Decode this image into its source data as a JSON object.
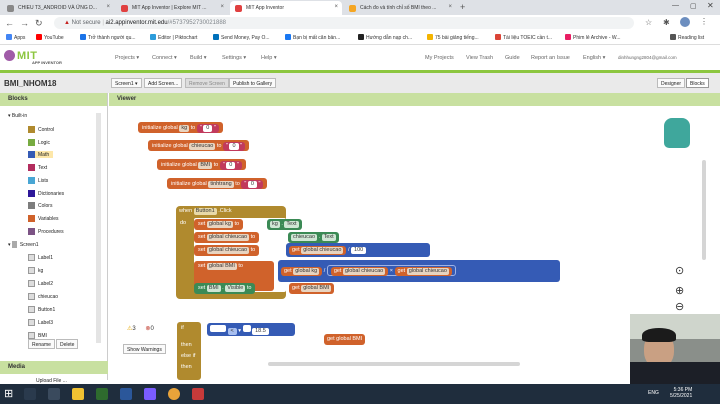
{
  "browser": {
    "tabs": [
      {
        "title": "CHIEU T3_ANDROID VÀ ỨNG D...",
        "favicon_color": "#888888"
      },
      {
        "title": "MIT App Inventor | Explore MIT ...",
        "favicon_color": "#e04040"
      },
      {
        "title": "MIT App Inventor",
        "favicon_color": "#e04040"
      },
      {
        "title": "Cách đo và tính chỉ số BMI theo ...",
        "favicon_color": "#f5a623"
      }
    ],
    "url_not_secure": "Not secure",
    "url_host": "ai2.appinventor.mit.edu",
    "url_rest": "/#5737952730021888",
    "bookmarks": [
      {
        "label": "Apps",
        "color": "#4285f4"
      },
      {
        "label": "YouTube",
        "color": "#ff0000"
      },
      {
        "label": "Trở thành người qu...",
        "color": "#1a73e8"
      },
      {
        "label": "Editor | Piktochart",
        "color": "#2c9cdb"
      },
      {
        "label": "Send Money, Pay O...",
        "color": "#0070ba"
      },
      {
        "label": "Bạn bị mất căn bản...",
        "color": "#1877f2"
      },
      {
        "label": "Hướng dẫn nạp ch...",
        "color": "#222222"
      },
      {
        "label": "75 bài giảng tiếng...",
        "color": "#f4b400"
      },
      {
        "label": "Tài liệu TOEIC cần t...",
        "color": "#db4437"
      },
      {
        "label": "Phim lẻ Archive - W...",
        "color": "#e91e63"
      }
    ],
    "reading_list": "Reading list"
  },
  "app": {
    "logo_main": "MIT",
    "logo_sub": "APP INVENTOR",
    "menus": [
      "Projects",
      "Connect",
      "Build",
      "Settings",
      "Help"
    ],
    "right_menus": [
      "My Projects",
      "View Trash",
      "Guide",
      "Report an Issue",
      "English",
      "dinhhungng2804@gmail.com"
    ],
    "project_name": "BMI_NHOM18",
    "toolbar": {
      "screen": "Screen1",
      "add_screen": "Add Screen...",
      "remove_screen": "Remove Screen",
      "publish": "Publish to Gallery",
      "designer": "Designer",
      "blocks": "Blocks"
    }
  },
  "blocks_panel": {
    "title": "Blocks",
    "builtin": "Built-in",
    "builtin_items": [
      {
        "label": "Control",
        "color": "#b08a2e"
      },
      {
        "label": "Logic",
        "color": "#77ab41"
      },
      {
        "label": "Math",
        "color": "#355bb5"
      },
      {
        "label": "Text",
        "color": "#b32d5e"
      },
      {
        "label": "Lists",
        "color": "#49a6d4"
      },
      {
        "label": "Dictionaries",
        "color": "#2d1799"
      },
      {
        "label": "Colors",
        "color": "#7d7d7d"
      },
      {
        "label": "Variables",
        "color": "#d0622b"
      },
      {
        "label": "Procedures",
        "color": "#7c5385"
      }
    ],
    "screen": "Screen1",
    "screen_items": [
      "Label1",
      "kg",
      "Label2",
      "chieucao",
      "Button1",
      "Label3",
      "BMI"
    ],
    "rename": "Rename",
    "delete": "Delete",
    "media_title": "Media",
    "upload": "Upload File ..."
  },
  "viewer": {
    "title": "Viewer",
    "globals": [
      {
        "label": "initialize global",
        "name": "kg",
        "to": "to",
        "value": "0"
      },
      {
        "label": "initialize global",
        "name": "chieucao",
        "to": "to",
        "value": "0"
      },
      {
        "label": "initialize global",
        "name": "BMI",
        "to": "to",
        "value": "0"
      },
      {
        "label": "initialize global",
        "name": "tinhtrang",
        "to": "to",
        "value": "0"
      }
    ],
    "event": {
      "when": "when",
      "component": "Button1",
      "event": ".Click",
      "do": "do"
    },
    "set_lines": {
      "set": "set",
      "to": "to",
      "global_kg": "global kg",
      "kg": "kg",
      "text": "Text",
      "global_chieucao": "global chieucao",
      "chieucao": "chieucao",
      "get": "get",
      "div": "/",
      "times": "×",
      "hundred": "100",
      "global_bmi": "global BMI",
      "bmi": "BMI",
      "visible": "Visible",
      "true": "true"
    },
    "warnings": {
      "warn_count": "3",
      "err_count": "0",
      "show": "Show Warnings"
    },
    "if_block": {
      "if": "if",
      "then": "then",
      "elseif": "else if",
      "lt": "<",
      "value": "18.5"
    },
    "loose_get": "get  global BMI"
  },
  "taskbar": {
    "time": "5:36 PM",
    "date": "5/25/2021",
    "lang": "ENG"
  }
}
